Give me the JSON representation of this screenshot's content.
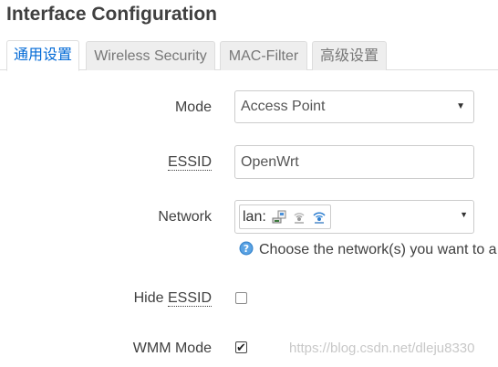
{
  "page": {
    "title": "Interface Configuration"
  },
  "tabs": [
    {
      "label": "通用设置",
      "active": true
    },
    {
      "label": "Wireless Security",
      "active": false
    },
    {
      "label": "MAC-Filter",
      "active": false
    },
    {
      "label": "高级设置",
      "active": false
    }
  ],
  "fields": {
    "mode": {
      "label": "Mode",
      "value": "Access Point"
    },
    "essid": {
      "label": "ESSID",
      "value": "OpenWrt"
    },
    "network": {
      "label": "Network",
      "value": "lan:",
      "icons": [
        "ethernet-port-icon",
        "wifi-disabled-icon",
        "wifi-signal-icon"
      ],
      "help": "Choose the network(s) you want to a"
    },
    "hide_essid": {
      "label_prefix": "Hide ",
      "label_abbr": "ESSID",
      "checked": false
    },
    "wmm_mode": {
      "label": "WMM Mode",
      "checked": true
    }
  },
  "watermark": "https://blog.csdn.net/dleju8330",
  "colors": {
    "active_tab_text": "#0069d6",
    "inactive_tab_bg": "#eeeeee",
    "border": "#cccccc",
    "text": "#404040"
  }
}
